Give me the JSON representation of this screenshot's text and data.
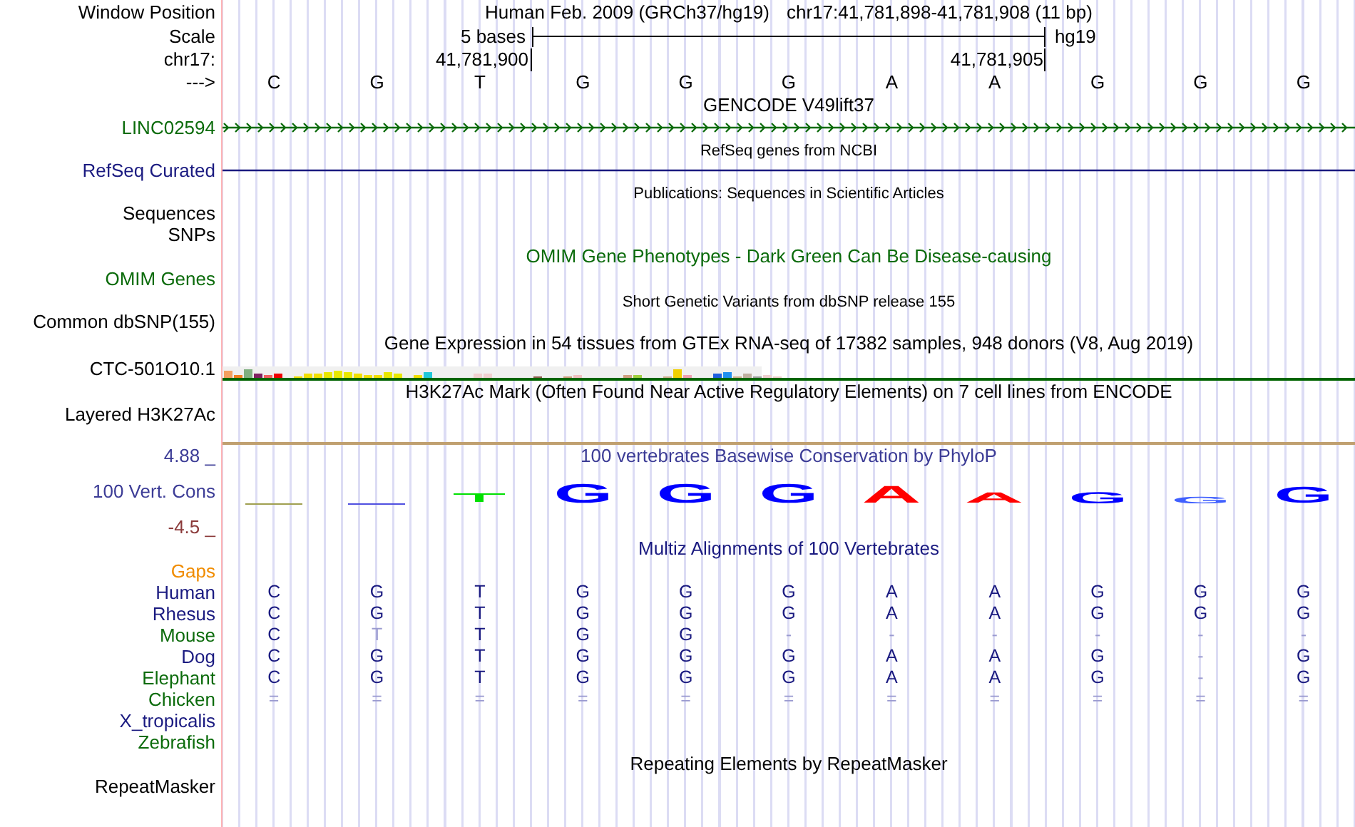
{
  "rows": [
    {
      "kind": "position",
      "label": "Window Position",
      "color": "#000000",
      "assembly": "Human Feb. 2009 (GRCh37/hg19)",
      "position": "chr17:41,781,898-41,781,908 (11 bp)"
    },
    {
      "kind": "scale",
      "label": "Scale",
      "color": "#000000",
      "span": "5 bases",
      "assembly": "hg19"
    },
    {
      "kind": "coords",
      "label": "chr17:",
      "color": "#000000",
      "start": "41,781,900",
      "end": "41,781,905"
    },
    {
      "kind": "bases",
      "label": "--->",
      "color": "#000000",
      "bases": [
        "C",
        "G",
        "T",
        "G",
        "G",
        "G",
        "A",
        "A",
        "G",
        "G",
        "G"
      ]
    },
    {
      "kind": "title",
      "title": "GENCODE V49lift37",
      "color": "#000000"
    },
    {
      "kind": "strand",
      "label": "LINC02594",
      "color": "#0b6b0b"
    },
    {
      "kind": "note",
      "title": "RefSeq genes from NCBI",
      "color": "#000000"
    },
    {
      "kind": "gene",
      "label": "RefSeq Curated",
      "color": "#1a1a80"
    },
    {
      "kind": "note",
      "title": "Publications: Sequences in Scientific Articles",
      "color": "#000000"
    },
    {
      "kind": "label",
      "label": "Sequences",
      "color": "#000000"
    },
    {
      "kind": "label",
      "label": "SNPs",
      "color": "#000000"
    },
    {
      "kind": "title",
      "title": "OMIM Gene Phenotypes - Dark Green Can Be Disease-causing",
      "color": "#0b6b0b"
    },
    {
      "kind": "label",
      "label": "OMIM Genes",
      "color": "#0b6b0b"
    },
    {
      "kind": "note",
      "title": "Short Genetic Variants from dbSNP release 155",
      "color": "#000000"
    },
    {
      "kind": "label",
      "label": "Common dbSNP(155)",
      "color": "#000000"
    },
    {
      "kind": "title",
      "title": "Gene Expression in 54 tissues from GTEx RNA-seq of 17382 samples, 948 donors (V8, Aug 2019)",
      "color": "#000000"
    },
    {
      "kind": "bars",
      "label": "CTC-501O10.1",
      "color": "#000000"
    },
    {
      "kind": "title",
      "title": "H3K27Ac Mark (Often Found Near Active Regulatory Elements) on 7 cell lines from ENCODE",
      "color": "#000000"
    },
    {
      "kind": "label",
      "label": "Layered H3K27Ac",
      "color": "#000000"
    },
    {
      "kind": "divider"
    },
    {
      "kind": "title",
      "label": "4.88 _",
      "title": "100 vertebrates Basewise Conservation by PhyloP",
      "color": "#3c3c96"
    },
    {
      "kind": "logo",
      "label": "100 Vert. Cons",
      "color": "#3c3c96",
      "columns": [
        {
          "kind": "line",
          "color": "#a0a050"
        },
        {
          "kind": "line",
          "color": "#5050e0"
        },
        {
          "kind": "mark",
          "color": "#00e000"
        },
        {
          "kind": "letter",
          "letter": "G",
          "color": "#0000ff"
        },
        {
          "kind": "letter",
          "letter": "G",
          "color": "#0000ff"
        },
        {
          "kind": "letter",
          "letter": "G",
          "color": "#0000ff"
        },
        {
          "kind": "letter",
          "letter": "A",
          "color": "#ff0000"
        },
        {
          "kind": "letter",
          "letter": "A",
          "color": "#ff0000"
        },
        {
          "kind": "letter",
          "letter": "G",
          "color": "#0000ff"
        },
        {
          "kind": "letter",
          "letter": "G",
          "color": "#4060ff"
        },
        {
          "kind": "letter",
          "letter": "G",
          "color": "#0000ff"
        }
      ]
    },
    {
      "kind": "label",
      "label": "-4.5 _",
      "color": "#8b3a3a"
    },
    {
      "kind": "title",
      "title": "Multiz Alignments of 100 Vertebrates",
      "color": "#1a1a80"
    },
    {
      "kind": "label",
      "label": "Gaps",
      "color": "#f08c00"
    },
    {
      "kind": "species",
      "label": "Human",
      "color": "#1a1a80",
      "bases": [
        {
          "b": "C",
          "faded": false
        },
        {
          "b": "G",
          "faded": false
        },
        {
          "b": "T",
          "faded": false
        },
        {
          "b": "G",
          "faded": false
        },
        {
          "b": "G",
          "faded": false
        },
        {
          "b": "G",
          "faded": false
        },
        {
          "b": "A",
          "faded": false
        },
        {
          "b": "A",
          "faded": false
        },
        {
          "b": "G",
          "faded": false
        },
        {
          "b": "G",
          "faded": false
        },
        {
          "b": "G",
          "faded": false
        }
      ]
    },
    {
      "kind": "species",
      "label": "Rhesus",
      "color": "#1a1a80",
      "bases": [
        {
          "b": "C",
          "faded": false
        },
        {
          "b": "G",
          "faded": false
        },
        {
          "b": "T",
          "faded": false
        },
        {
          "b": "G",
          "faded": false
        },
        {
          "b": "G",
          "faded": false
        },
        {
          "b": "G",
          "faded": false
        },
        {
          "b": "A",
          "faded": false
        },
        {
          "b": "A",
          "faded": false
        },
        {
          "b": "G",
          "faded": false
        },
        {
          "b": "G",
          "faded": false
        },
        {
          "b": "G",
          "faded": false
        }
      ]
    },
    {
      "kind": "species",
      "label": "Mouse",
      "color": "#0b6b0b",
      "bases": [
        {
          "b": "C",
          "faded": false
        },
        {
          "b": "T",
          "faded": true
        },
        {
          "b": "T",
          "faded": false
        },
        {
          "b": "G",
          "faded": false
        },
        {
          "b": "G",
          "faded": false
        },
        {
          "b": "-",
          "faded": true
        },
        {
          "b": "-",
          "faded": true
        },
        {
          "b": "-",
          "faded": true
        },
        {
          "b": "-",
          "faded": true
        },
        {
          "b": "-",
          "faded": true
        },
        {
          "b": "-",
          "faded": true
        }
      ]
    },
    {
      "kind": "species",
      "label": "Dog",
      "color": "#1a1a80",
      "bases": [
        {
          "b": "C",
          "faded": false
        },
        {
          "b": "G",
          "faded": false
        },
        {
          "b": "T",
          "faded": false
        },
        {
          "b": "G",
          "faded": false
        },
        {
          "b": "G",
          "faded": false
        },
        {
          "b": "G",
          "faded": false
        },
        {
          "b": "A",
          "faded": false
        },
        {
          "b": "A",
          "faded": false
        },
        {
          "b": "G",
          "faded": false
        },
        {
          "b": "-",
          "faded": true
        },
        {
          "b": "G",
          "faded": false
        }
      ]
    },
    {
      "kind": "species",
      "label": "Elephant",
      "color": "#0b6b0b",
      "bases": [
        {
          "b": "C",
          "faded": false
        },
        {
          "b": "G",
          "faded": false
        },
        {
          "b": "T",
          "faded": false
        },
        {
          "b": "G",
          "faded": false
        },
        {
          "b": "G",
          "faded": false
        },
        {
          "b": "G",
          "faded": false
        },
        {
          "b": "A",
          "faded": false
        },
        {
          "b": "A",
          "faded": false
        },
        {
          "b": "G",
          "faded": false
        },
        {
          "b": "-",
          "faded": true
        },
        {
          "b": "G",
          "faded": false
        }
      ]
    },
    {
      "kind": "species",
      "label": "Chicken",
      "color": "#0b6b0b",
      "bases": [
        {
          "b": "=",
          "faded": true
        },
        {
          "b": "=",
          "faded": true
        },
        {
          "b": "=",
          "faded": true
        },
        {
          "b": "=",
          "faded": true
        },
        {
          "b": "=",
          "faded": true
        },
        {
          "b": "=",
          "faded": true
        },
        {
          "b": "=",
          "faded": true
        },
        {
          "b": "=",
          "faded": true
        },
        {
          "b": "=",
          "faded": true
        },
        {
          "b": "=",
          "faded": true
        },
        {
          "b": "=",
          "faded": true
        }
      ]
    },
    {
      "kind": "species",
      "label": "X_tropicalis",
      "color": "#1a1a80"
    },
    {
      "kind": "species",
      "label": "Zebrafish",
      "color": "#0b6b0b"
    },
    {
      "kind": "title",
      "title": "Repeating Elements by RepeatMasker",
      "color": "#000000"
    },
    {
      "kind": "label",
      "label": "RepeatMasker",
      "color": "#000000"
    }
  ]
}
